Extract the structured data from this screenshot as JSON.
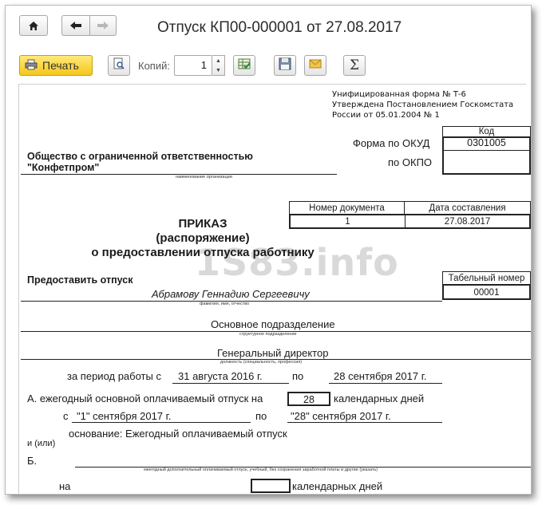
{
  "window": {
    "title": "Отпуск КП00-000001 от 27.08.2017"
  },
  "nav": {
    "home_icon": "home-icon",
    "back_icon": "arrow-left-icon",
    "forward_icon": "arrow-right-icon"
  },
  "toolbar": {
    "print_label": "Печать",
    "copies_label": "Копий:",
    "copies_value": "1",
    "icons": [
      "print-preview-icon",
      "table-settings-icon",
      "save-icon",
      "envelope-icon",
      "sigma-icon"
    ]
  },
  "doc": {
    "form_header": {
      "line1": "Унифицированная форма № Т-6",
      "line2": "Утверждена Постановлением Госкомстата",
      "line3": "России от 05.01.2004 № 1"
    },
    "code_header": "Код",
    "okud_label": "Форма по ОКУД",
    "okud_value": "0301005",
    "okpo_label": "по ОКПО",
    "okpo_value": "",
    "org_line1": "Общество с ограниченной ответственностью",
    "org_line2": "\"Конфетпром\"",
    "org_caption": "наименование организации",
    "doc_number_header": "Номер документа",
    "doc_date_header": "Дата составления",
    "doc_number": "1",
    "doc_date": "27.08.2017",
    "title1": "ПРИКАЗ",
    "title2": "(распоряжение)",
    "title3": "о предоставлении отпуска работнику",
    "watermark": "1S83.info",
    "grant_label": "Предоставить отпуск",
    "tab_header": "Табельный номер",
    "tab_number": "00001",
    "employee": "Абрамову Геннадию Сергеевичу",
    "employee_caption": "фамилия, имя, отчество",
    "department": "Основное подразделение",
    "department_caption": "структурное подразделение",
    "position": "Генеральный директор",
    "position_caption": "должность (специальность, профессия)",
    "period_label": "за период работы с",
    "period_from": "31 августа 2016 г.",
    "period_to_label": "по",
    "period_to": "28 сентября 2017 г.",
    "a_label": "А. ежегодный основной оплачиваемый отпуск на",
    "a_days": "28",
    "a_days_label": "календарных дней",
    "a_from_label": "с",
    "a_from": "\"1\" сентября 2017 г.",
    "a_to_label": "по",
    "a_to": "\"28\" сентября 2017 г.",
    "basis": "основание: Ежегодный оплачиваемый отпуск",
    "and_or": "и (или)",
    "b_label": "Б.",
    "b_caption": "ежегодный дополнительный оплачиваемый отпуск, учебный, без сохранения заработной платы и другие (указать)",
    "b_na": "на",
    "b_days": "",
    "b_days_label": "календарных дней"
  }
}
